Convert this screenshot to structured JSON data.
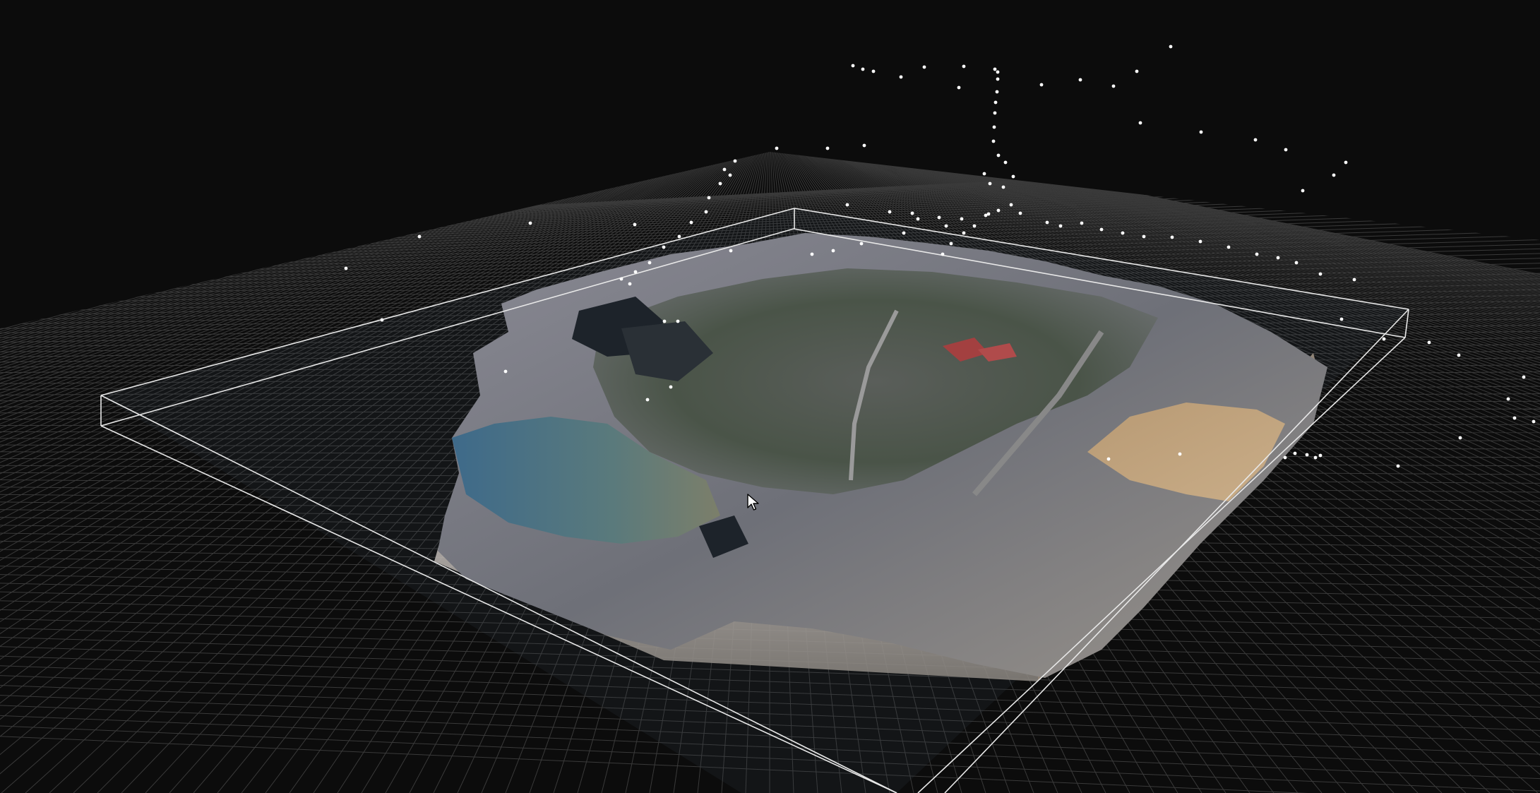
{
  "scene": {
    "view": "3d-viewport",
    "background_color": "#0c0c0c",
    "grid_color": "#3a3a3a",
    "bounding_box_color": "#ffffff",
    "point_color": "#ffffff",
    "grid_visible": true,
    "bounding_box_visible": true,
    "camera_points_visible": true
  },
  "icons": {
    "cursor": "mouse-pointer-icon"
  }
}
